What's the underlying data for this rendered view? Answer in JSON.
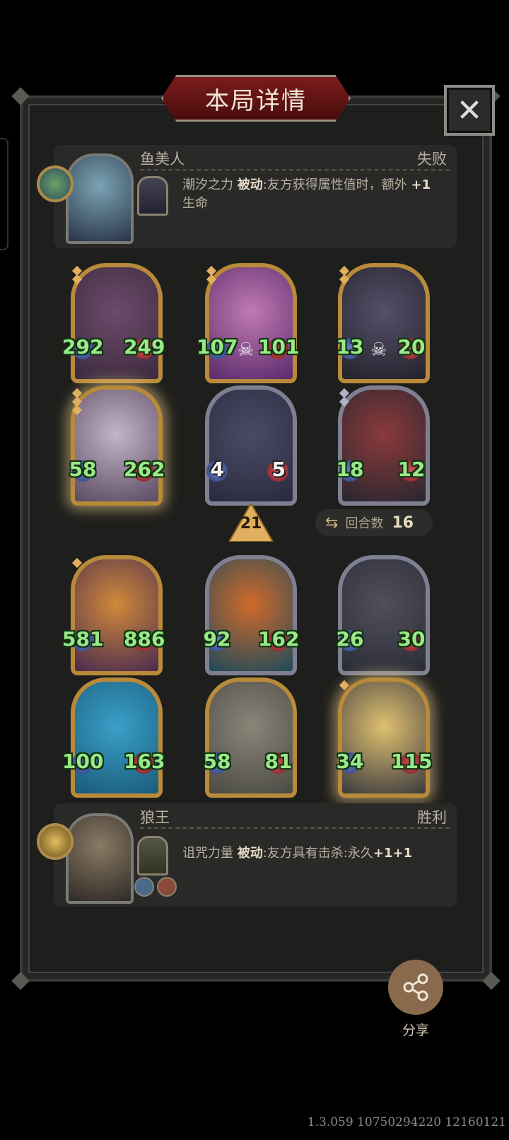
{
  "header": {
    "title": "本局详情",
    "close_icon": "✕"
  },
  "top_player": {
    "name": "鱼美人",
    "result": "失败",
    "skill_name": "潮汐之力",
    "skill_tag": "被动",
    "skill_desc": ":友方获得属性值时，额外",
    "skill_bonus": "+1",
    "skill_suffix": "生命"
  },
  "cards_row1": [
    {
      "atk": "292",
      "hp": "249",
      "frame": "gold",
      "art": [
        "#3b2a3e",
        "#6c4a6a"
      ],
      "gems": 2
    },
    {
      "atk": "107",
      "hp": "101",
      "frame": "gold",
      "art": [
        "#5a2a6a",
        "#c07ab4"
      ],
      "gems": 2,
      "skull": "☠"
    },
    {
      "atk": "13",
      "hp": "20",
      "frame": "gold",
      "art": [
        "#22222a",
        "#55506a"
      ],
      "gems": 2,
      "skull": "☠"
    }
  ],
  "cards_row2": [
    {
      "atk": "58",
      "hp": "262",
      "frame": "gold",
      "art": [
        "#5a4a62",
        "#c4b4c8"
      ],
      "gems": 3,
      "glow": true
    },
    {
      "atk": "4",
      "hp": "5",
      "frame": "silver",
      "art": [
        "#2a2a3e",
        "#4a4a66"
      ],
      "gems": 0,
      "white": true
    },
    {
      "atk": "18",
      "hp": "12",
      "frame": "silver",
      "art": [
        "#2a2630",
        "#8a3a3a"
      ],
      "gems": 2,
      "silver_gems": true
    }
  ],
  "tier": "21",
  "rounds": {
    "icon": "⇆",
    "label": "回合数",
    "value": "16"
  },
  "cards_row3": [
    {
      "atk": "581",
      "hp": "886",
      "frame": "gold",
      "art": [
        "#4a2a4e",
        "#d08a3a"
      ],
      "gems": 1
    },
    {
      "atk": "92",
      "hp": "162",
      "frame": "silver",
      "art": [
        "#1e4a5a",
        "#d06a2a"
      ],
      "gems": 0
    },
    {
      "atk": "26",
      "hp": "30",
      "frame": "silver",
      "art": [
        "#2a2c36",
        "#50505c"
      ],
      "gems": 0
    }
  ],
  "cards_row4": [
    {
      "atk": "100",
      "hp": "163",
      "frame": "gold",
      "art": [
        "#1a5a7a",
        "#3aa0c8"
      ],
      "gems": 0
    },
    {
      "atk": "58",
      "hp": "81",
      "frame": "gold",
      "art": [
        "#4a4a44",
        "#8a8478"
      ],
      "gems": 0
    },
    {
      "atk": "34",
      "hp": "115",
      "frame": "gold",
      "art": [
        "#3a3a3e",
        "#e0c070"
      ],
      "gems": 1,
      "glow": true
    }
  ],
  "bottom_player": {
    "name": "狼王",
    "result": "胜利",
    "skill_name": "诅咒力量",
    "skill_tag": "被动",
    "skill_desc": ":友方具有击杀:永久",
    "skill_bonus": "+1+1"
  },
  "share": {
    "label": "分享",
    "icon": "share-icon"
  },
  "version": "1.3.059 10750294220 12160121",
  "colors": {
    "gold_frame": "#b88a3a",
    "silver_frame": "#7e8092",
    "stat_green": "#9be88a",
    "title_red": "#7a1c1c"
  }
}
